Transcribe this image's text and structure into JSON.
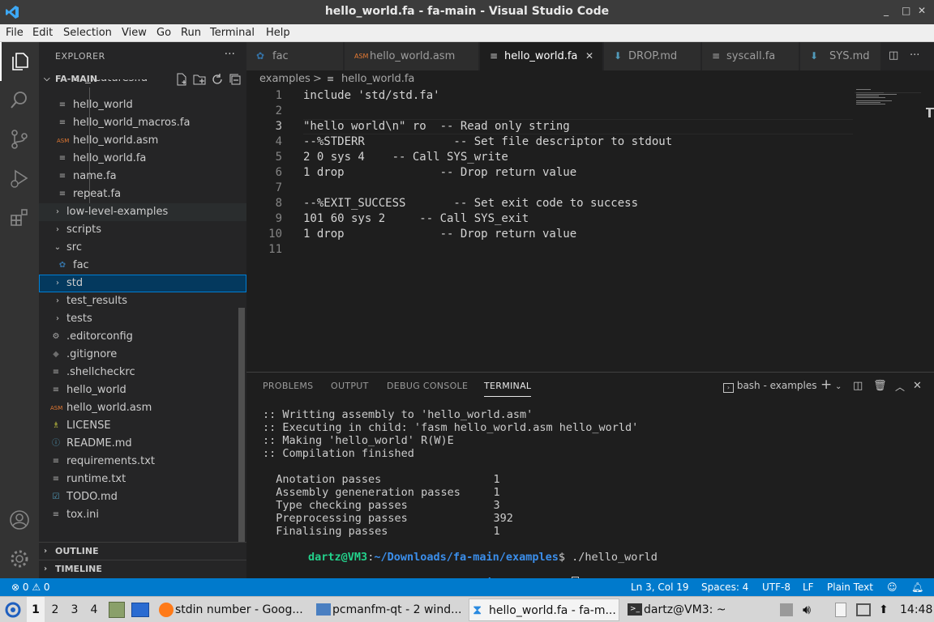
{
  "window": {
    "title": "hello_world.fa - fa-main - Visual Studio Code",
    "controls": [
      "_",
      "□",
      "✕"
    ]
  },
  "menu": [
    "File",
    "Edit",
    "Selection",
    "View",
    "Go",
    "Run",
    "Terminal",
    "Help"
  ],
  "explorer": {
    "header": "EXPLORER",
    "more": "···",
    "root": "FA-MAIN",
    "tree": [
      {
        "label": "all_features.fa",
        "icon": "fa-file-icon"
      },
      {
        "label": "hello_world",
        "icon": "file-icon"
      },
      {
        "label": "hello_world_macros.fa",
        "icon": "fa-file-icon"
      },
      {
        "label": "hello_world.asm",
        "icon": "asm-file-icon"
      },
      {
        "label": "hello_world.fa",
        "icon": "fa-file-icon"
      },
      {
        "label": "name.fa",
        "icon": "fa-file-icon"
      },
      {
        "label": "repeat.fa",
        "icon": "fa-file-icon"
      },
      {
        "label": "low-level-examples",
        "icon": "chevron-right-icon"
      },
      {
        "label": "scripts",
        "icon": "chevron-right-icon"
      },
      {
        "label": "src",
        "icon": "chevron-down-icon"
      },
      {
        "label": "fac",
        "icon": "python-icon"
      },
      {
        "label": "std",
        "icon": "chevron-right-icon"
      },
      {
        "label": "test_results",
        "icon": "chevron-right-icon"
      },
      {
        "label": "tests",
        "icon": "chevron-right-icon"
      },
      {
        "label": ".editorconfig",
        "icon": "gear-icon"
      },
      {
        "label": ".gitignore",
        "icon": "git-icon"
      },
      {
        "label": ".shellcheckrc",
        "icon": "file-icon"
      },
      {
        "label": "hello_world",
        "icon": "file-icon"
      },
      {
        "label": "hello_world.asm",
        "icon": "asm-file-icon"
      },
      {
        "label": "LICENSE",
        "icon": "license-icon"
      },
      {
        "label": "README.md",
        "icon": "info-icon"
      },
      {
        "label": "requirements.txt",
        "icon": "file-icon"
      },
      {
        "label": "runtime.txt",
        "icon": "file-icon"
      },
      {
        "label": "TODO.md",
        "icon": "checkbox-icon"
      },
      {
        "label": "tox.ini",
        "icon": "file-icon"
      }
    ],
    "outline": "OUTLINE",
    "timeline": "TIMELINE"
  },
  "tabs": [
    {
      "label": "fac",
      "icon": "python-icon"
    },
    {
      "label": "hello_world.asm",
      "icon": "asm-file-icon"
    },
    {
      "label": "hello_world.fa",
      "icon": "fa-file-icon",
      "active": true
    },
    {
      "label": "DROP.md",
      "icon": "info-icon"
    },
    {
      "label": "syscall.fa",
      "icon": "fa-file-icon"
    },
    {
      "label": "SYS.md",
      "icon": "info-icon"
    }
  ],
  "breadcrumb": {
    "folder": "examples",
    "sep": ">",
    "file": "hello_world.fa"
  },
  "editor": {
    "current_line": 3,
    "lines": [
      {
        "n": "1",
        "text": "include 'std/std.fa'"
      },
      {
        "n": "2",
        "text": ""
      },
      {
        "n": "3",
        "text": "\"hello world\\n\" ro  -- Read only string"
      },
      {
        "n": "4",
        "text": "--%STDERR             -- Set file descriptor to stdout"
      },
      {
        "n": "5",
        "text": "2 0 sys 4    -- Call SYS_write"
      },
      {
        "n": "6",
        "text": "1 drop              -- Drop return value"
      },
      {
        "n": "7",
        "text": ""
      },
      {
        "n": "8",
        "text": "--%EXIT_SUCCESS       -- Set exit code to success"
      },
      {
        "n": "9",
        "text": "101 60 sys 2     -- Call SYS_exit"
      },
      {
        "n": "10",
        "text": "1 drop              -- Drop return value"
      },
      {
        "n": "11",
        "text": ""
      }
    ]
  },
  "panel": {
    "tabs": [
      "PROBLEMS",
      "OUTPUT",
      "DEBUG CONSOLE",
      "TERMINAL"
    ],
    "active_tab": "TERMINAL",
    "shell": "bash - examples",
    "terminal": [
      {
        "text": ":: Writting assembly to 'hello_world.asm'"
      },
      {
        "text": ":: Executing in child: 'fasm hello_world.asm hello_world'"
      },
      {
        "text": ":: Making 'hello_world' R(W)E"
      },
      {
        "text": ":: Compilation finished"
      },
      {
        "text": ""
      },
      {
        "text": "  Anotation passes                 1"
      },
      {
        "text": "  Assembly geneneration passes     1"
      },
      {
        "text": "  Type checking passes             3"
      },
      {
        "text": "  Preprocessing passes             392"
      },
      {
        "text": "  Finalising passes                1"
      }
    ],
    "prompt_user": "dartz@VM3",
    "prompt_path": "~/Downloads/fa-main/examples",
    "prompt_cmd": "$ ./hello_world",
    "prompt_end": "$ "
  },
  "statusbar": {
    "problems": "⊗ 0 ⚠ 0",
    "position": "Ln 3, Col 19",
    "spaces": "Spaces: 4",
    "encoding": "UTF-8",
    "eol": "LF",
    "language": "Plain Text"
  },
  "taskbar": {
    "workspaces": [
      "1",
      "2",
      "3",
      "4"
    ],
    "tasks": [
      {
        "label": "stdin number - Goog...",
        "icon": "firefox-icon"
      },
      {
        "label": "pcmanfm-qt - 2 wind...",
        "icon": "folder-icon"
      },
      {
        "label": "hello_world.fa - fa-m...",
        "icon": "vscode-icon",
        "active": true
      },
      {
        "label": "dartz@VM3: ~",
        "icon": "terminal-icon"
      }
    ],
    "clock": "14:48"
  },
  "colors": {
    "accent": "#007acc",
    "prompt_user": "#23d18b",
    "prompt_path": "#3b8eea",
    "selection": "#04395e"
  }
}
